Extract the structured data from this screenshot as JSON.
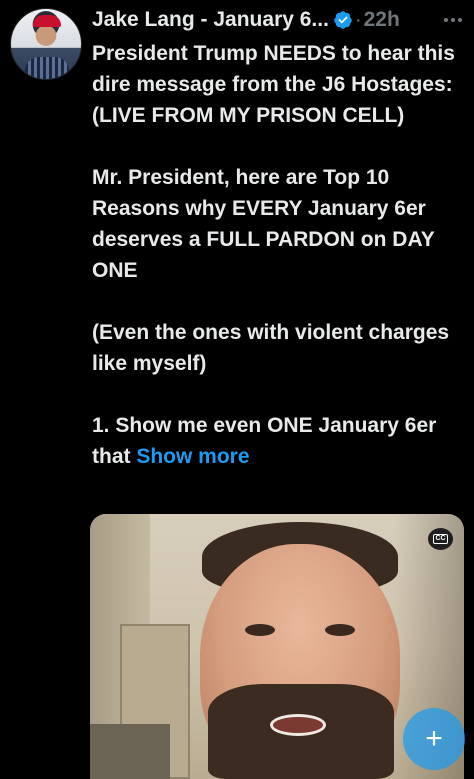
{
  "post": {
    "author_name": "Jake Lang - January 6...",
    "separator": "·",
    "timestamp": "22h",
    "paragraphs": [
      "President Trump NEEDS to hear this dire message from the J6 Hostages: (LIVE FROM MY PRISON CELL)",
      "Mr. President, here are Top 10 Reasons why EVERY January 6er deserves a FULL PARDON on DAY ONE",
      "(Even the ones with violent charges like myself)",
      "1. Show me even ONE January 6er that"
    ],
    "show_more_label": "Show more"
  },
  "media": {
    "cc_label": "CC"
  },
  "fab": {
    "label": "+"
  },
  "colors": {
    "background": "#000000",
    "text": "#e7e9ea",
    "muted": "#71767b",
    "accent": "#1d9bf0"
  },
  "icons": [
    "verified-badge-icon",
    "more-options-icon",
    "closed-captions-icon",
    "compose-icon"
  ]
}
